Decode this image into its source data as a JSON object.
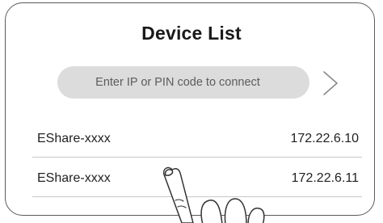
{
  "header": {
    "title": "Device List"
  },
  "connect": {
    "placeholder": "Enter IP or PIN code to connect",
    "submit_icon": "chevron-right-icon"
  },
  "devices": [
    {
      "name": "EShare-xxxx",
      "ip": "172.22.6.10"
    },
    {
      "name": "EShare-xxxx",
      "ip": "172.22.6.11"
    }
  ],
  "overlay": {
    "icon": "pointing-hand-icon"
  },
  "colors": {
    "panel_border": "#5a5a5a",
    "search_fill": "#dcdcdc",
    "text": "#222222",
    "divider": "#c8c8c8"
  }
}
